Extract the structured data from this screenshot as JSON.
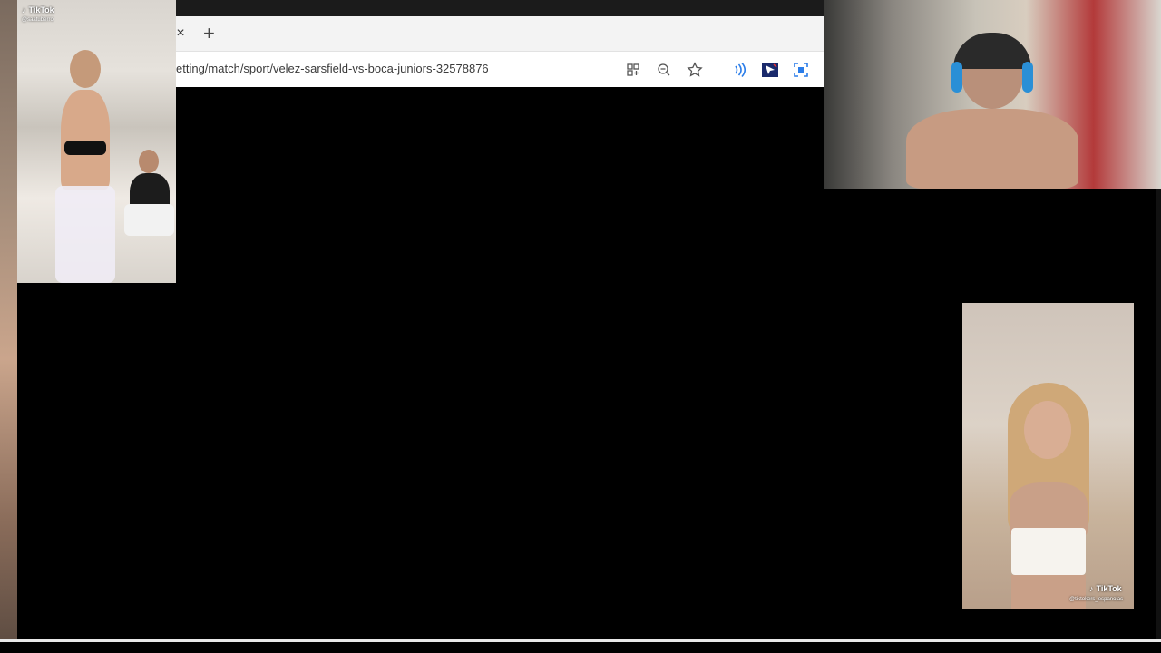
{
  "browser": {
    "tab_close_glyph": "×",
    "new_tab_glyph": "+",
    "url": "etting/match/sport/velez-sarsfield-vs-boca-juniors-32578876"
  },
  "address_icons": [
    {
      "name": "apps-icon",
      "glyph": "⊞"
    },
    {
      "name": "zoom-out-icon",
      "glyph": "⊖"
    },
    {
      "name": "favorite-star-icon",
      "glyph": "☆"
    },
    {
      "name": "read-aloud-icon",
      "glyph": "))"
    },
    {
      "name": "extension-icon",
      "glyph": "⬛"
    },
    {
      "name": "screenshot-icon",
      "glyph": "⛶"
    }
  ],
  "tiles": {
    "top_left": {
      "badge": "TikTok",
      "handle": "@saatuberro"
    },
    "bottom_right": {
      "badge": "TikTok",
      "handle": "@tiktokers_espanolas"
    }
  }
}
